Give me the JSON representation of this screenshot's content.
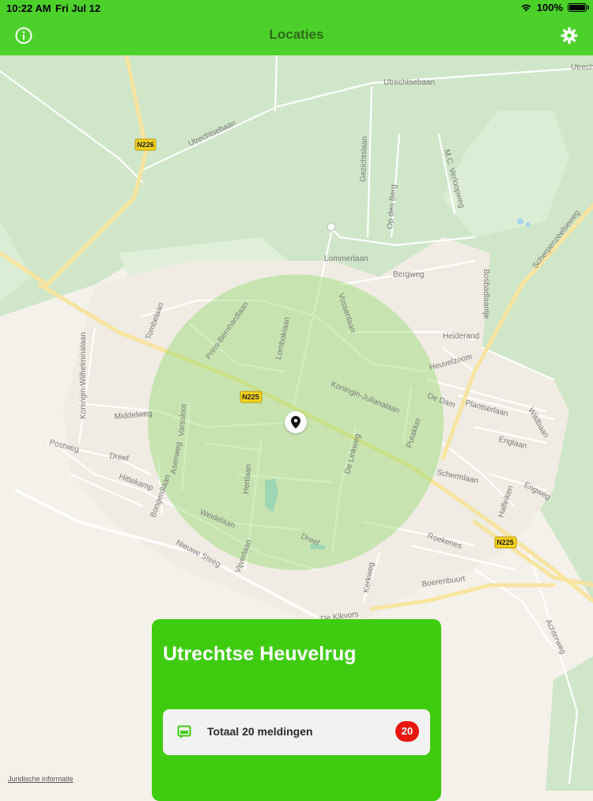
{
  "status_bar": {
    "time": "10:22 AM",
    "date": "Fri Jul 12",
    "battery": "100%"
  },
  "header": {
    "title": "Locaties",
    "left_icon": "info-icon",
    "right_icon": "gear-icon"
  },
  "colors": {
    "header": "#4cd12a",
    "title_text": "#2d6a18",
    "card": "#3fcc10",
    "badge": "#e8160f",
    "radius_circle": "#8fd86a"
  },
  "map": {
    "road_labels": [
      "Utrechtsebaan",
      "Utrechtsebaan",
      "Utrechtsebaan",
      "Gezichtslaan",
      "M.C. Verloopweg",
      "Op den Berg",
      "Scherpenzeelseweg",
      "Lommerlaan",
      "Bergweg",
      "Bosbadlaantje",
      "Heiderand",
      "Tombelaan",
      "Prins-Bernhardlaan",
      "Lombokiaan",
      "Vossenlaan",
      "Koningin-Wilhelminalaan",
      "Heuvelzoom",
      "Koningin-Julianalaan",
      "De Dam",
      "Plantserlaan",
      "Wildbaan",
      "Middelweg",
      "Varssloot",
      "Putakker",
      "Englaan",
      "Postweg",
      "Dreef",
      "Asenweg",
      "Hertlaan",
      "De Linkweg",
      "Schermlaan",
      "Engweg",
      "Hittekamp",
      "Bongerdlaan",
      "Halfeiken",
      "Weidelaan",
      "Dreef",
      "Roekenes",
      "Nieuwe Steeg",
      "Vijverlaan",
      "Kerkweg",
      "Boerenbuurt",
      "De Kikvors",
      "Achterweg"
    ],
    "shields": [
      "N226",
      "N225",
      "N225"
    ]
  },
  "card": {
    "title": "Utrechtse Heuvelrug",
    "row_icon": "message-icon",
    "row_label": "Totaal 20 meldingen",
    "badge": "20"
  },
  "legal_link": "Juridische informatie"
}
